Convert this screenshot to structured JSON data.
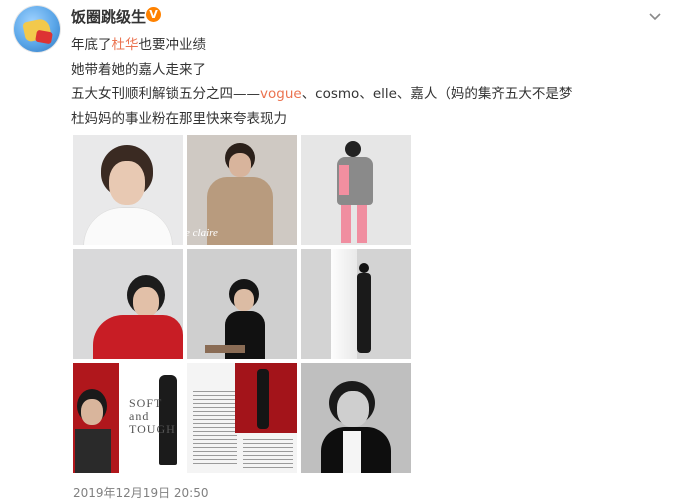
{
  "post": {
    "author": "饭圈跳级生",
    "verified_badge": "V",
    "lines": [
      {
        "parts": [
          {
            "t": "年底了"
          },
          {
            "t": "杜华",
            "hl": true
          },
          {
            "t": "也要冲业绩"
          }
        ]
      },
      {
        "parts": [
          {
            "t": "她带着她的嘉人走来了"
          }
        ]
      },
      {
        "parts": [
          {
            "t": "五大女刊顺利解锁五分之四——"
          },
          {
            "t": "vogue",
            "hl": true
          },
          {
            "t": "、cosmo、elle、嘉人（妈的集齐五大不是梦"
          }
        ]
      },
      {
        "parts": [
          {
            "t": "杜妈妈的事业粉在那里快来夸表现力"
          }
        ]
      }
    ],
    "timestamp": "2019年12月19日 20:50"
  },
  "photos": [
    {
      "name": "photo-1",
      "bg": "#e9e9ea"
    },
    {
      "name": "photo-2",
      "bg": "#cfc9c3",
      "overlay": "e claire"
    },
    {
      "name": "photo-3",
      "bg": "#e6e6e6"
    },
    {
      "name": "photo-4",
      "bg": "#d9d9da"
    },
    {
      "name": "photo-5",
      "bg": "#cfcfcf"
    },
    {
      "name": "photo-6",
      "bg": "#d3d3d3"
    },
    {
      "name": "photo-7",
      "bg": "#ffffff",
      "overlay": "SOFT and TOUGH"
    },
    {
      "name": "photo-8",
      "bg": "#f4f4f4"
    },
    {
      "name": "photo-9",
      "bg": "#bfbfbf"
    }
  ],
  "colors": {
    "highlight": "#eb7350",
    "badge": "#ff8200",
    "timestamp": "#808080"
  }
}
